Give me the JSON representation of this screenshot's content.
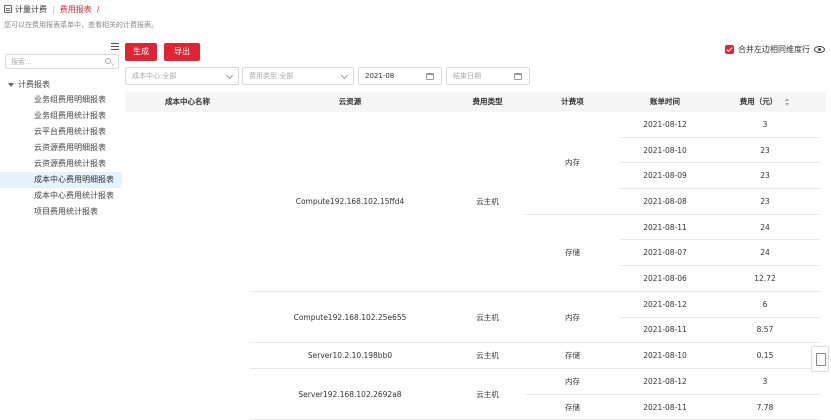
{
  "breadcrumb": {
    "root": "计量计费",
    "current": "费用报表",
    "slash": "/"
  },
  "description": "您可以在费用报表菜单中，查看相关的计费报表。",
  "sidebar": {
    "search_placeholder": "搜索...",
    "tree_root": "计费报表",
    "items": [
      {
        "label": "业务组费用明细报表",
        "selected": false
      },
      {
        "label": "业务组费用统计报表",
        "selected": false
      },
      {
        "label": "云平台费用统计报表",
        "selected": false
      },
      {
        "label": "云资源费用明细报表",
        "selected": false
      },
      {
        "label": "云资源费用统计报表",
        "selected": false
      },
      {
        "label": "成本中心费用明细报表",
        "selected": true
      },
      {
        "label": "成本中心费用统计报表",
        "selected": false
      },
      {
        "label": "项目费用统计报表",
        "selected": false
      }
    ]
  },
  "toolbar": {
    "generate_label": "生成",
    "export_label": "导出",
    "merge_label": "合并左边相同维度行",
    "merge_checked": true
  },
  "filters": {
    "cost_center_placeholder": "成本中心:全部",
    "fee_type_placeholder": "费用类型:全部",
    "start_date": "2021-08",
    "end_date_placeholder": "结束日期"
  },
  "table": {
    "headers": [
      "成本中心名称",
      "云资源",
      "费用类型",
      "计费项",
      "账单时间",
      "费用（元）"
    ],
    "rows": [
      {
        "date": "2021-08-12",
        "cost": "3"
      },
      {
        "date": "2021-08-10",
        "cost": "23"
      },
      {
        "date": "2021-08-09",
        "cost": "23"
      },
      {
        "date": "2021-08-08",
        "cost": "23"
      },
      {
        "date": "2021-08-11",
        "cost": "24"
      },
      {
        "date": "2021-08-07",
        "cost": "24"
      },
      {
        "date": "2021-08-06",
        "cost": "12.72"
      },
      {
        "date": "2021-08-12",
        "cost": "6"
      },
      {
        "date": "2021-08-11",
        "cost": "8.57"
      },
      {
        "date": "2021-08-10",
        "cost": "0.15"
      },
      {
        "date": "2021-08-12",
        "cost": "3"
      },
      {
        "date": "2021-08-11",
        "cost": "7.78"
      }
    ],
    "resource_groups": [
      {
        "resource": "Compute192.168.102.15ffd4",
        "fee_type": "云主机",
        "start": 0,
        "span": 7
      },
      {
        "resource": "Compute192.168.102.25e655",
        "fee_type": "云主机",
        "start": 7,
        "span": 2
      },
      {
        "resource": "Server10.2.10.198bb0",
        "fee_type": "云主机",
        "start": 9,
        "span": 1
      },
      {
        "resource": "Server192.168.102.2692a8",
        "fee_type": "云主机",
        "start": 10,
        "span": 2
      }
    ],
    "item_groups": [
      {
        "item": "内存",
        "start": 0,
        "span": 4
      },
      {
        "item": "存储",
        "start": 4,
        "span": 3
      },
      {
        "item": "内存",
        "start": 7,
        "span": 2
      },
      {
        "item": "存储",
        "start": 9,
        "span": 1
      },
      {
        "item": "内存",
        "start": 10,
        "span": 1
      },
      {
        "item": "存储",
        "start": 11,
        "span": 1
      }
    ]
  }
}
